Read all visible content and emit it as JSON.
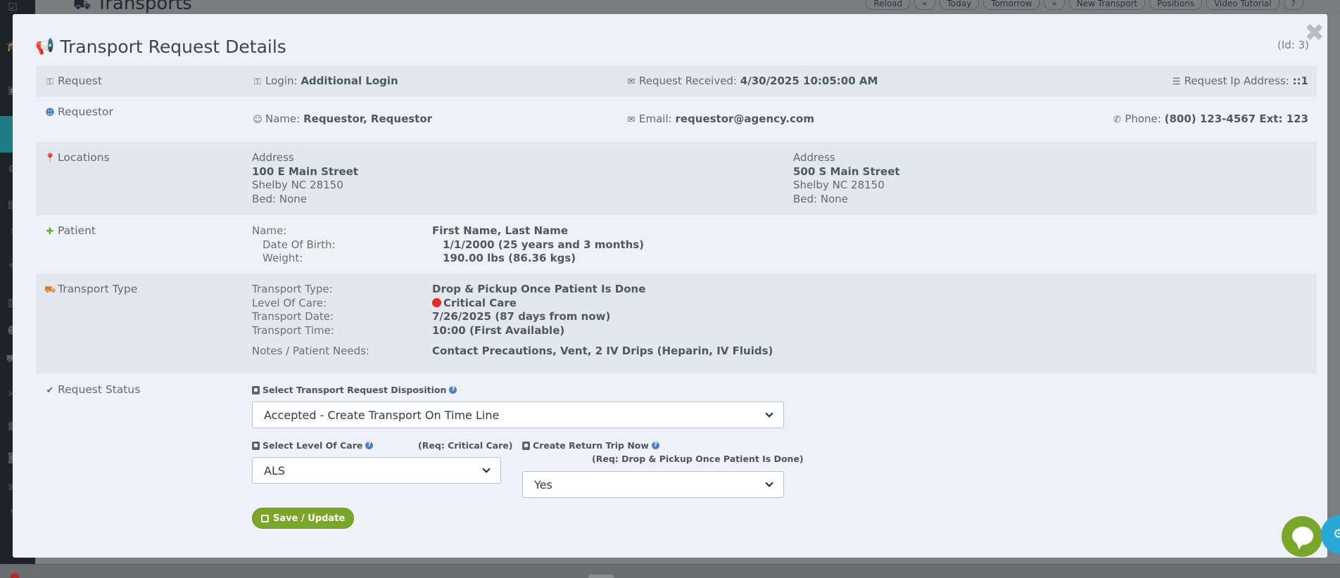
{
  "background": {
    "page_title": "Transports",
    "toolbar": [
      "Reload",
      "«",
      "Today",
      "Tomorrow",
      "»",
      "New Transport",
      "Positions",
      "Video Tutorial",
      "?"
    ]
  },
  "modal": {
    "title": "Transport Request Details",
    "id_label": "(Id: 3)",
    "close_glyph": "✖",
    "request": {
      "section": "Request",
      "login_label": "Login:",
      "login_value": "Additional Login",
      "received_label": "Request Received:",
      "received_value": "4/30/2025 10:05:00 AM",
      "ip_label": "Request Ip Address:",
      "ip_value": "::1"
    },
    "requestor": {
      "section": "Requestor",
      "name_label": "Name:",
      "name_value": "Requestor, Requestor",
      "email_label": "Email:",
      "email_value": "requestor@agency.com",
      "phone_label": "Phone:",
      "phone_value": "(800) 123-4567 Ext: 123"
    },
    "locations": {
      "section": "Locations",
      "from": {
        "heading": "Address",
        "street": "100 E Main Street",
        "city": "Shelby NC 28150",
        "bed": "Bed: None"
      },
      "to": {
        "heading": "Address",
        "street": "500 S Main Street",
        "city": "Shelby NC 28150",
        "bed": "Bed: None"
      }
    },
    "patient": {
      "section": "Patient",
      "name_label": "Name:",
      "name_value": "First Name, Last Name",
      "dob_label": "Date Of Birth:",
      "dob_value": "1/1/2000 (25 years and 3 months)",
      "weight_label": "Weight:",
      "weight_value": "190.00 lbs (86.36 kgs)"
    },
    "transport": {
      "section": "Transport Type",
      "type_label": "Transport Type:",
      "type_value": "Drop & Pickup Once Patient Is Done",
      "loc_label": "Level Of Care:",
      "loc_value": "Critical Care",
      "date_label": "Transport Date:",
      "date_value": "7/26/2025 (87 days from now)",
      "time_label": "Transport Time:",
      "time_value": "10:00 (First Available)",
      "notes_label": "Notes / Patient Needs:",
      "notes_value": "Contact Precautions, Vent, 2 IV Drips (Heparin, IV Fluids)"
    },
    "status": {
      "section": "Request Status",
      "disposition_label": "Select Transport Request Disposition",
      "disposition_value": "Accepted - Create Transport On Time Line",
      "level_label": "Select Level Of Care",
      "level_req": "(Req: Critical Care)",
      "level_value": "ALS",
      "return_label": "Create Return Trip Now",
      "return_req": "(Req: Drop & Pickup Once Patient Is Done)",
      "return_value": "Yes",
      "save_label": "Save / Update"
    }
  },
  "colors": {
    "accent_green": "#7aa72a",
    "modal_bg": "#eef2f6",
    "row_shade": "#e3e8ee",
    "critical_red": "#e02b2b"
  }
}
